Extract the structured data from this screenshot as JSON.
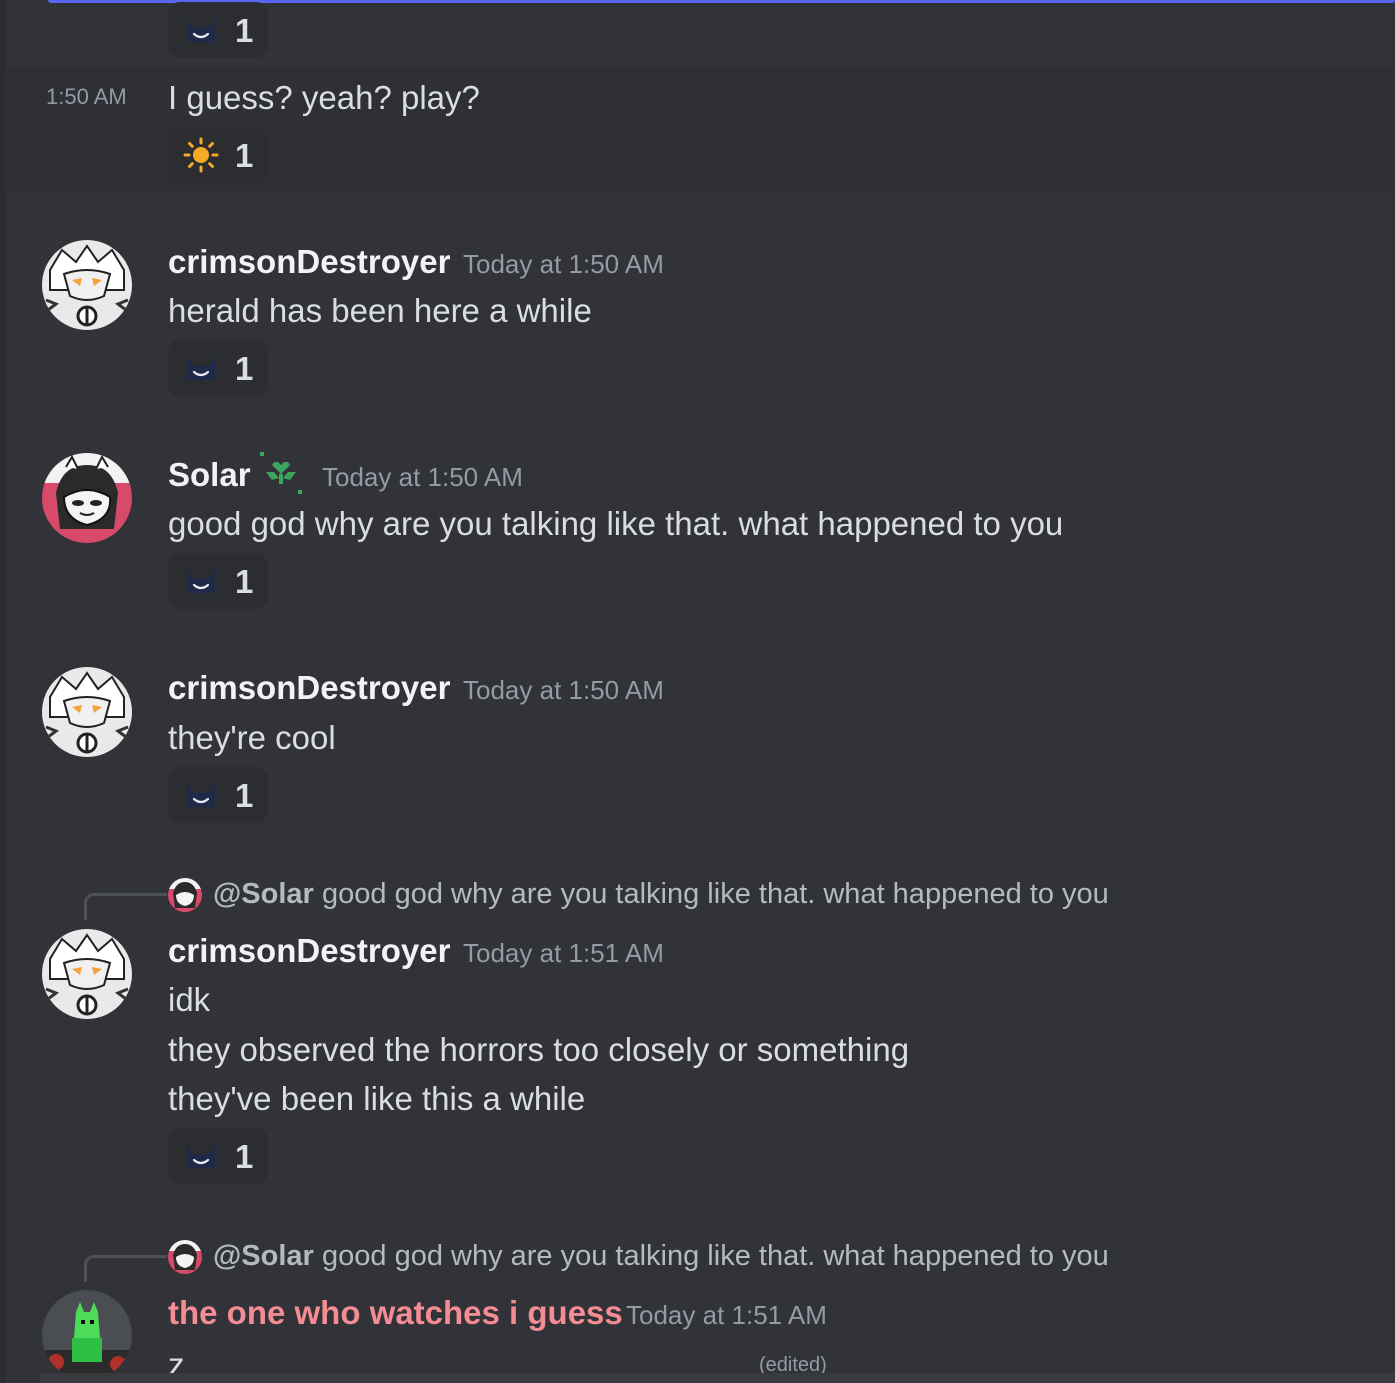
{
  "messages": {
    "partial_top": {
      "reaction": {
        "emoji": "hat-smile-emoji",
        "count": "1"
      }
    },
    "m1": {
      "time": "1:50 AM",
      "text": "I guess? yeah? play?",
      "reaction": {
        "emoji": "sun-emoji",
        "count": "1"
      }
    },
    "m2": {
      "author": "crimsonDestroyer",
      "timestamp": "Today at 1:50 AM",
      "text": "herald has been here a while",
      "reaction": {
        "emoji": "hat-smile-emoji",
        "count": "1"
      }
    },
    "m3": {
      "author": "Solar",
      "author_badge": "sprout-heart-icon",
      "timestamp": "Today at 1:50 AM",
      "text": "good god why are you talking like that. what happened to you",
      "reaction": {
        "emoji": "hat-smile-emoji",
        "count": "1"
      }
    },
    "m4": {
      "author": "crimsonDestroyer",
      "timestamp": "Today at 1:50 AM",
      "text": "they're cool",
      "reaction": {
        "emoji": "hat-smile-emoji",
        "count": "1"
      }
    },
    "m5": {
      "reply": {
        "mention": "@Solar",
        "text": "good god why are you talking like that. what happened to you"
      },
      "author": "crimsonDestroyer",
      "timestamp": "Today at 1:51 AM",
      "lines": [
        "idk",
        "they observed the horrors too closely or something",
        "they've been like this a while"
      ],
      "reaction": {
        "emoji": "hat-smile-emoji",
        "count": "1"
      }
    },
    "m6": {
      "reply": {
        "mention": "@Solar",
        "text": "good god why are you talking like that. what happened to you"
      },
      "author": "the one who watches i guess",
      "author_color": "#f48c94",
      "timestamp": "Today at 1:51 AM",
      "text": "z",
      "edited": "(edited)"
    }
  },
  "colors": {
    "background": "#313338",
    "accent": "#5865f2",
    "reaction_bg": "#2b2d31",
    "muted_text": "#949ba4"
  }
}
